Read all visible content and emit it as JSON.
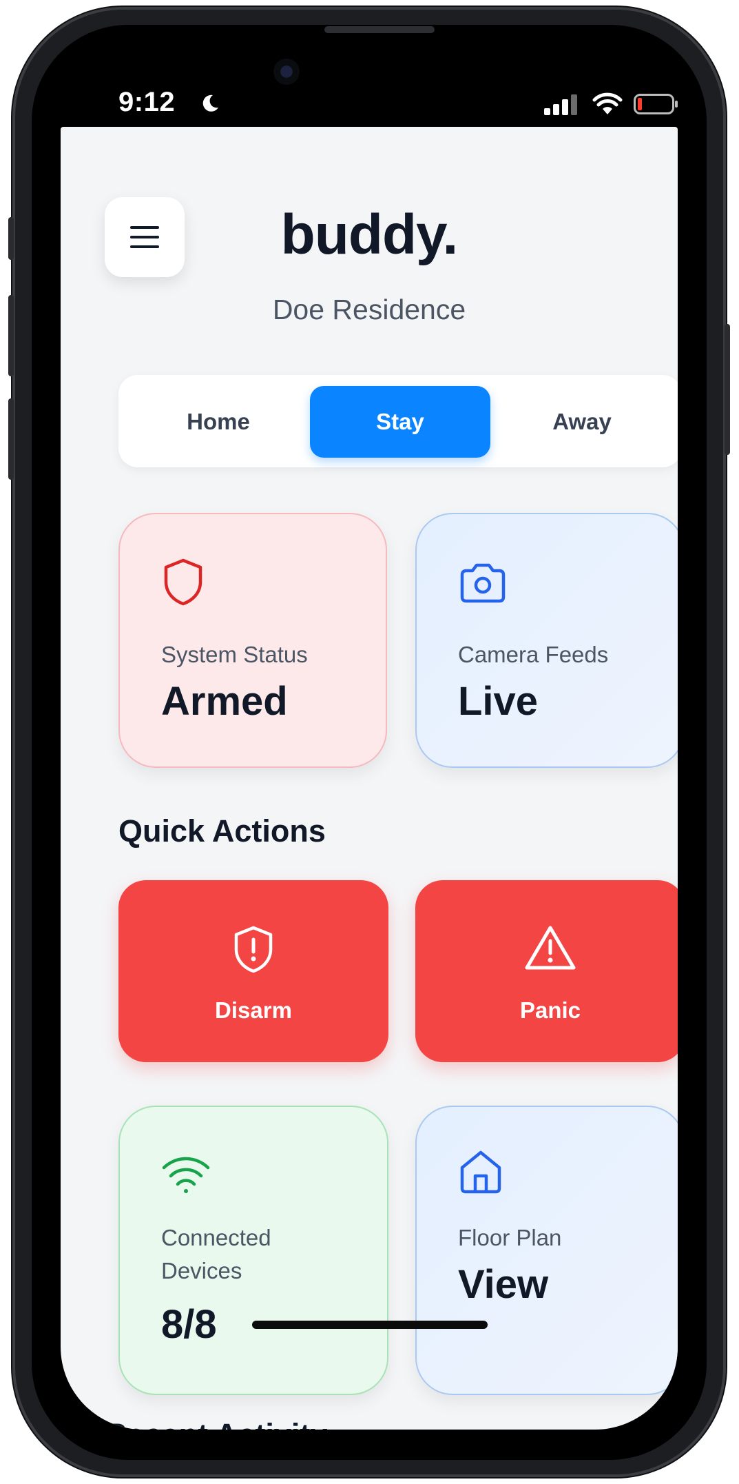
{
  "status_bar": {
    "time": "9:12",
    "icons": [
      "moon-icon",
      "cellular-signal-icon",
      "wifi-icon",
      "battery-low-icon"
    ],
    "battery_color": "#ff3b30"
  },
  "header": {
    "menu_icon": "hamburger-menu-icon",
    "app_title": "buddy.",
    "residence": "Doe Residence"
  },
  "mode_toggle": {
    "tabs": [
      {
        "label": "Home",
        "active": false
      },
      {
        "label": "Stay",
        "active": true
      },
      {
        "label": "Away",
        "active": false
      }
    ],
    "active_color": "#0a84ff"
  },
  "status_cards": [
    {
      "icon": "shield-icon",
      "label": "System Status",
      "value": "Armed",
      "accent": "#dc2626"
    },
    {
      "icon": "camera-icon",
      "label": "Camera Feeds",
      "value": "Live",
      "accent": "#2563eb"
    }
  ],
  "quick_actions": {
    "title": "Quick Actions",
    "buttons": [
      {
        "icon": "shield-alert-icon",
        "label": "Disarm"
      },
      {
        "icon": "warning-triangle-icon",
        "label": "Panic"
      }
    ],
    "color": "#f44545"
  },
  "info_cards": [
    {
      "icon": "wifi-icon",
      "label_line1": "Connected",
      "label_line2": "Devices",
      "value": "8/8",
      "accent": "#16a34a"
    },
    {
      "icon": "house-icon",
      "label": "Floor Plan",
      "value": "View",
      "accent": "#2563eb"
    }
  ],
  "recent_activity": {
    "title": "Recent Activity"
  }
}
